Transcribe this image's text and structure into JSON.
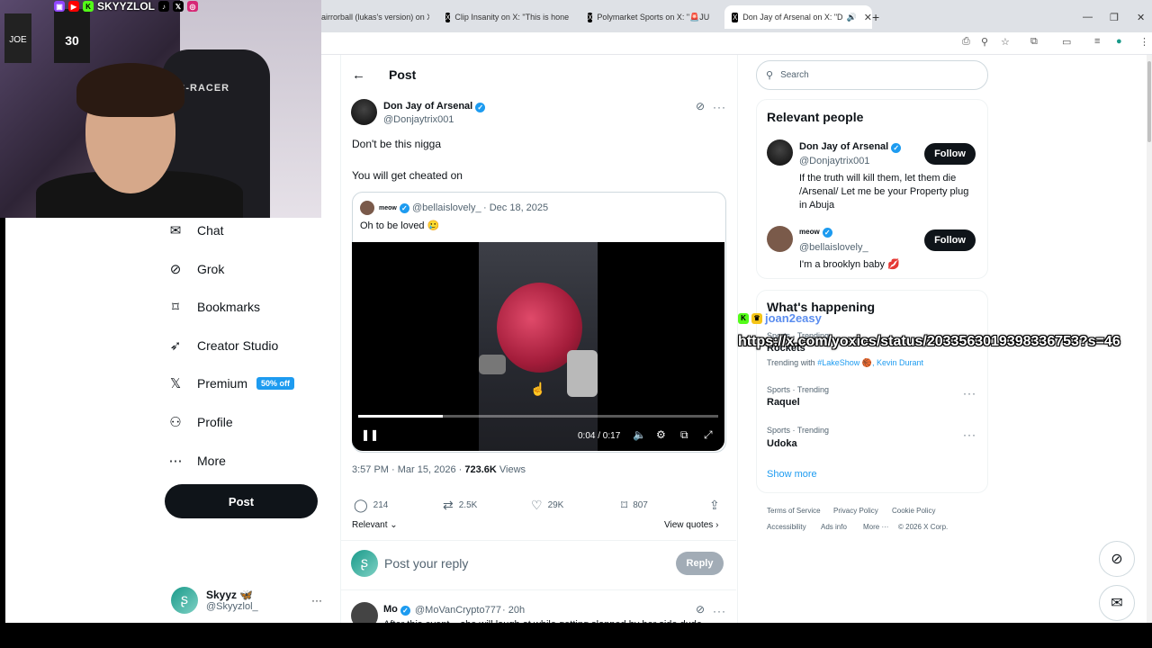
{
  "stream": {
    "channel_name": "SKYYZLOL",
    "social_icons": [
      "twitch-icon",
      "youtube-icon",
      "kick-icon",
      "tiktok-icon",
      "x-icon",
      "instagram-icon"
    ],
    "jersey_number": "30",
    "jersey_text": "JOE",
    "chair_brand": "S-RACER"
  },
  "browser": {
    "tabs": [
      {
        "title": "airrorball (lukas's version) on X",
        "active": false
      },
      {
        "title": "Clip Insanity on X: \"This is hone",
        "active": false
      },
      {
        "title": "Polymarket Sports on X: \"🚨JU",
        "active": false
      },
      {
        "title": "Don Jay of Arsenal on X: \"D",
        "active": true
      }
    ],
    "new_tab": "+"
  },
  "sidebar": {
    "items": [
      {
        "label": "Chat",
        "icon": "mail-icon"
      },
      {
        "label": "Grok",
        "icon": "grok-icon"
      },
      {
        "label": "Bookmarks",
        "icon": "bookmark-icon"
      },
      {
        "label": "Creator Studio",
        "icon": "rocket-icon"
      },
      {
        "label": "Premium",
        "icon": "x-logo-icon",
        "badge": "50% off"
      },
      {
        "label": "Profile",
        "icon": "person-icon"
      },
      {
        "label": "More",
        "icon": "more-circle-icon"
      }
    ],
    "post_button": "Post",
    "account": {
      "name": "Skyyz 🦋",
      "handle": "@Skyyzlol_"
    }
  },
  "main": {
    "header_title": "Post",
    "post": {
      "author": "Don Jay of Arsenal",
      "handle": "@Donjaytrix001",
      "text1": "Don't be this nigga",
      "text2": "You will get cheated on",
      "quote": {
        "author": "meow",
        "handle": "@bellaislovely_",
        "date": "· Dec 18, 2025",
        "text": "Oh to be loved 🥲"
      },
      "video": {
        "time": "0:04 / 0:17",
        "progress": 0.235
      },
      "timestamp": "3:57 PM · Mar 15, 2026 ·",
      "views_count": "723.6K",
      "views_label": "Views",
      "stats": {
        "replies": "214",
        "reposts": "2.5K",
        "likes": "29K",
        "bookmarks": "807"
      },
      "relevant": "Relevant",
      "view_quotes": "View quotes"
    },
    "reply": {
      "placeholder": "Post your reply",
      "button": "Reply"
    },
    "next_reply": {
      "author": "Mo",
      "handle": "@MoVanCrypto777",
      "time": "· 20h",
      "text": "After this event... she will laugh at while getting slapped by her side dude"
    }
  },
  "right": {
    "search_placeholder": "Search",
    "relevant_title": "Relevant people",
    "people": [
      {
        "name": "Don Jay of Arsenal",
        "handle": "@Donjaytrix001",
        "bio": "If the truth will kill them, let them die /Arsenal/ Let me be your Property plug in Abuja",
        "follow": "Follow"
      },
      {
        "name": "meow",
        "handle": "@bellaislovely_",
        "bio": "I'm a brooklyn baby 💋",
        "follow": "Follow"
      }
    ],
    "happening_title": "What's happening",
    "trends": [
      {
        "category": "Sports · Trending",
        "name": "Rockets",
        "extra_prefix": "Trending with",
        "extra_tags": "#LakeShow 🏀, Kevin Durant"
      },
      {
        "category": "Sports · Trending",
        "name": "Raquel"
      },
      {
        "category": "Sports · Trending",
        "name": "Udoka"
      }
    ],
    "show_more": "Show more",
    "footer": [
      "Terms of Service",
      "Privacy Policy",
      "Cookie Policy",
      "Accessibility",
      "Ads info",
      "More ···",
      "© 2026 X Corp."
    ]
  },
  "overlay": {
    "chat_user": "joan2easy",
    "url": "https://x.com/yoxics/status/2033563019398336753?s=46"
  }
}
